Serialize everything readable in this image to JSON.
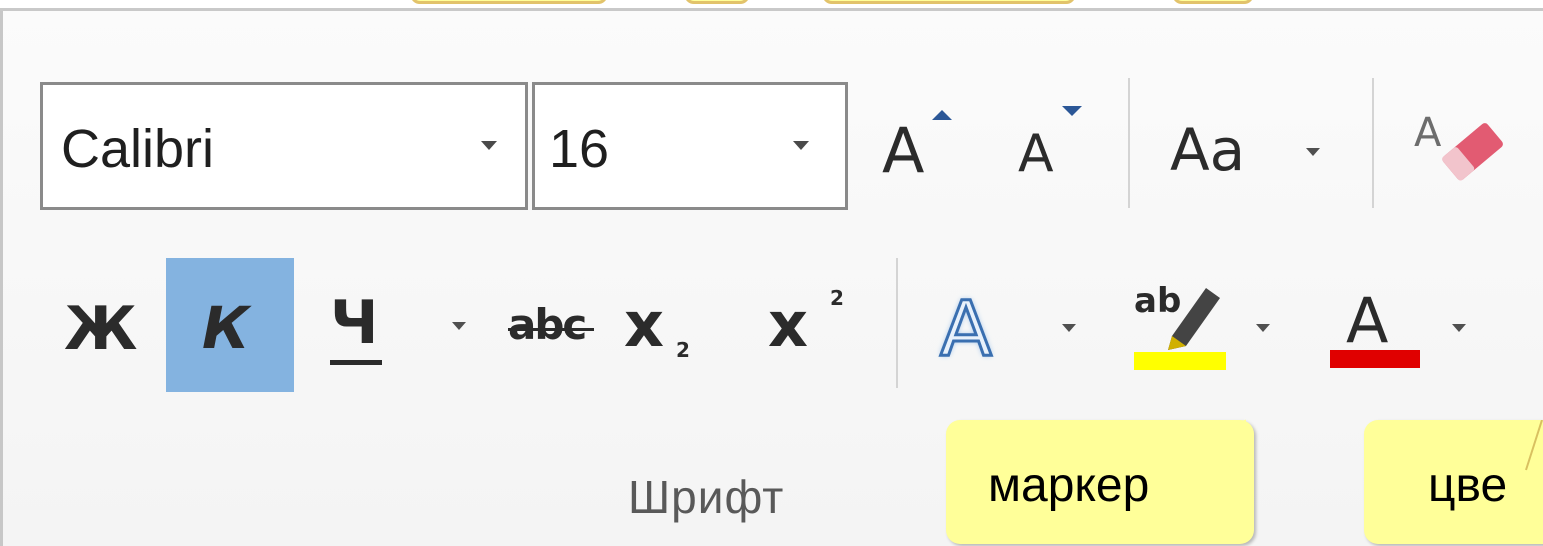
{
  "font_group": {
    "font_name": "Calibri",
    "font_size": "16",
    "grow_font_glyph": "A",
    "shrink_font_glyph": "A",
    "change_case_glyph": "Aa",
    "bold_glyph": "Ж",
    "italic_glyph": "К",
    "underline_glyph": "Ч",
    "strikethrough_glyph": "abc",
    "subscript_glyph": "x",
    "subscript_mark": "2",
    "superscript_glyph": "x",
    "superscript_mark": "2",
    "text_effects_glyph": "A",
    "highlight_glyph": "ab",
    "font_color_glyph": "A",
    "group_label": "Шрифт"
  },
  "callouts": {
    "marker": "маркер",
    "color": "цве"
  },
  "colors": {
    "italic_active_bg": "#84b3e0",
    "highlight_bar": "#ffff00",
    "font_color_bar": "#e00000",
    "callout_fill": "#ffff99"
  },
  "icons": [
    "grow-font-icon",
    "shrink-font-icon",
    "change-case-icon",
    "clear-formatting-icon",
    "text-effects-icon",
    "highlight-marker-icon",
    "font-color-icon"
  ]
}
